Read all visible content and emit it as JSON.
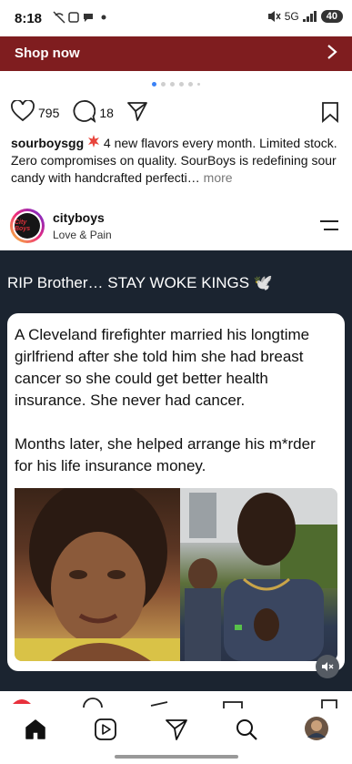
{
  "status_bar": {
    "time": "8:18",
    "network": "5G",
    "battery": "40"
  },
  "shop_bar": {
    "label": "Shop now"
  },
  "post_actions": {
    "likes": "795",
    "comments": "18"
  },
  "caption": {
    "username": "sourboysgg",
    "text": "4 new flavors every month. Limited stock. Zero compromises on quality. SourBoys is redefining sour candy with handcrafted perfecti…",
    "more": "more"
  },
  "post_header": {
    "username": "cityboys",
    "subtitle": "Love & Pain",
    "avatar_text": "City Boys"
  },
  "post": {
    "headline": "RIP Brother… STAY WOKE KINGS 🕊️",
    "paragraph1": "A Cleveland firefighter married his longtime girlfriend after she told him she had breast cancer so she could get better health insurance. She never had cancer.",
    "paragraph2": "Months later, she helped arrange his m*rder for his life insurance money."
  },
  "colors": {
    "shop_bar": "#7f1d1f",
    "post_bg": "#1b2430",
    "dot_active": "#3b82f6"
  },
  "bottom_nav": [
    "home-icon",
    "reels-icon",
    "direct-message-icon",
    "search-icon",
    "profile-avatar"
  ]
}
